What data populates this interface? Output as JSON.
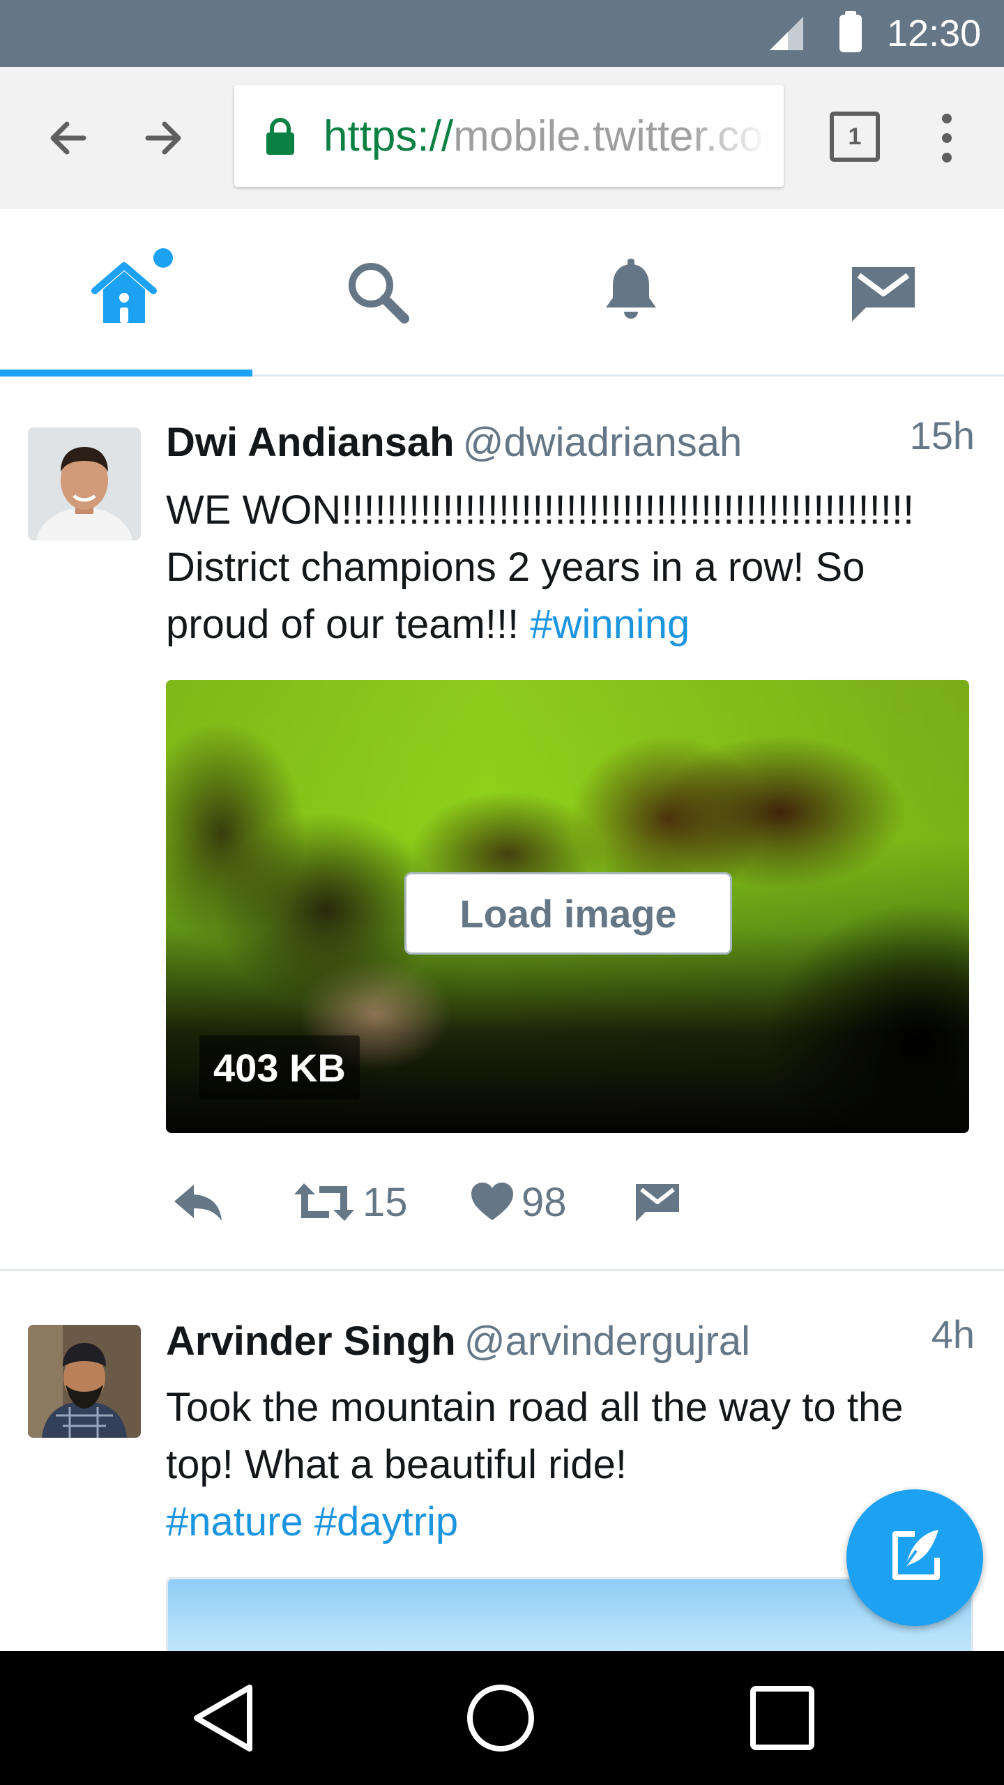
{
  "status_bar": {
    "time": "12:30"
  },
  "browser": {
    "url_scheme": "https://",
    "url_rest": "mobile.twitter.com",
    "tab_count": "1"
  },
  "nav_tabs": [
    {
      "name": "home",
      "icon": "home-icon",
      "active": true
    },
    {
      "name": "search",
      "icon": "search-icon"
    },
    {
      "name": "notifications",
      "icon": "bell-icon"
    },
    {
      "name": "messages",
      "icon": "envelope-icon"
    }
  ],
  "tweets": [
    {
      "name": "Dwi Andiansah",
      "handle": "@dwiadriansah",
      "time": "15h",
      "line1": "WE WON!!!!!!!!!!!!!!!!!!!!!!!!!!!!!!!!!!!!!!!!!!!!!!!!!!!",
      "line2": "District champions 2 years in a row! So",
      "line3_text": "proud of our team!!! ",
      "line3_tag": "#winning",
      "load_image_label": "Load image",
      "media_size": "403 KB",
      "retweets": "15",
      "likes": "98"
    },
    {
      "name": "Arvinder Singh",
      "handle": "@arvindergujral",
      "time": "4h",
      "line1": "Took the mountain road all the way to the",
      "line2": "top! What a beautiful ride!",
      "tag1": "#nature",
      "tag2": "#daytrip"
    }
  ],
  "colors": {
    "twitter_blue": "#1da1f2",
    "status_bar": "#657786",
    "text_secondary": "#657786",
    "link": "#1b95e0"
  }
}
